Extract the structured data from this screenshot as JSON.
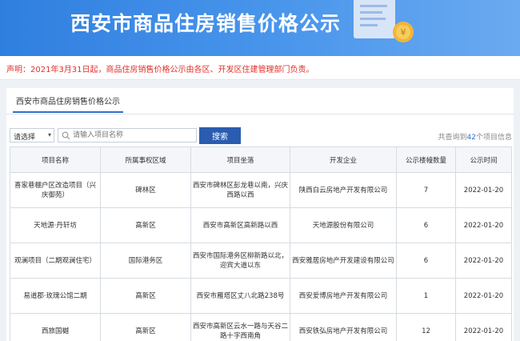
{
  "header": {
    "title": "西安市商品住房销售价格公示"
  },
  "notice": {
    "text": "声明：2021年3月31日起，商品住房销售价格公示由各区、开发区住建管理部门负责。"
  },
  "tabs": [
    {
      "label": "西安市商品住房销售价格公示"
    }
  ],
  "search": {
    "select_value": "请选择",
    "placeholder": "请输入项目名称",
    "button_label": "搜索",
    "total_prefix": "共查询到",
    "total_count": "42",
    "total_suffix": "个项目信息"
  },
  "table": {
    "headers": [
      "项目名称",
      "所属事权区域",
      "项目坐落",
      "开发企业",
      "公示楼幢数量",
      "公示时间"
    ],
    "rows": [
      [
        "喜家巷棚户区改造项目（兴庆御苑）",
        "碑林区",
        "西安市碑林区彭龙巷以南，兴庆西路以西",
        "陕西白云房地产开发有限公司",
        "7",
        "2022-01-20"
      ],
      [
        "天地源·丹轩坊",
        "高新区",
        "西安市高新区高新路以西",
        "天地源股份有限公司",
        "6",
        "2022-01-20"
      ],
      [
        "观澜项目（二期观澜住宅）",
        "国际港务区",
        "西安市国际港务区柳新路以北，迎宾大道以东",
        "西安雅居房地产开发建设有限公司",
        "6",
        "2022-01-20"
      ],
      [
        "易道郡·玫瑰公馆二期",
        "高新区",
        "西安市雁塔区丈八北路238号",
        "西安爱博房地产开发有限公司",
        "1",
        "2022-01-20"
      ],
      [
        "西旅国樾",
        "高新区",
        "西安市高新区云水一路与天谷二路十字西南角",
        "西安铁弘房地产开发有限公司",
        "12",
        "2022-01-20"
      ]
    ]
  }
}
